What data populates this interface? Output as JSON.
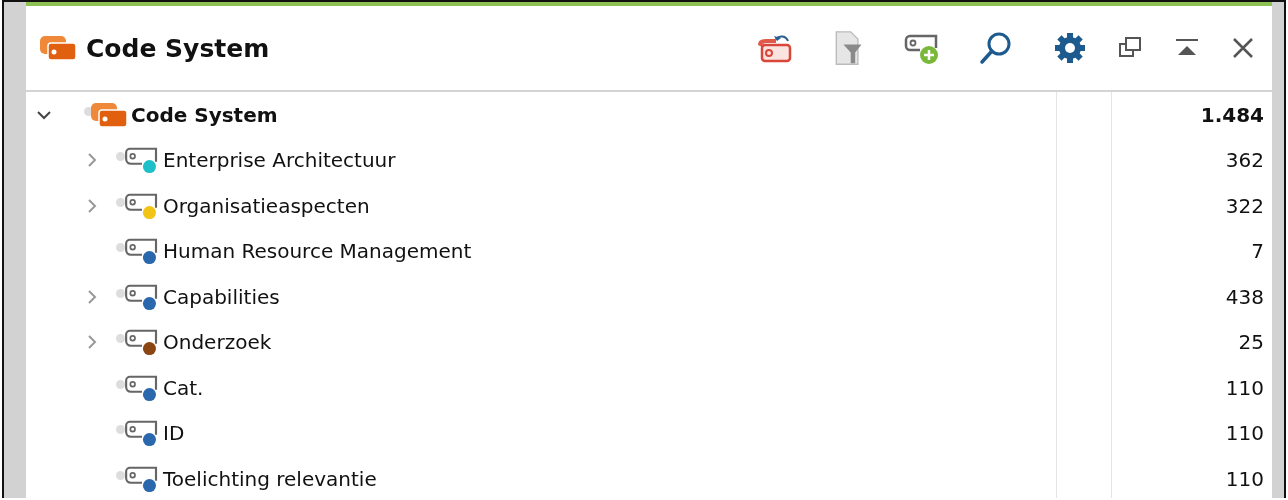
{
  "panel": {
    "title": "Code System"
  },
  "tree": {
    "label": "Code System",
    "count": "1.484",
    "expanded": true,
    "children": [
      {
        "label": "Enterprise Architectuur",
        "count": "362",
        "expandable": true,
        "color": "#1fbfc9"
      },
      {
        "label": "Organisatieaspecten",
        "count": "322",
        "expandable": true,
        "color": "#f2c416"
      },
      {
        "label": "Human Resource Management",
        "count": "7",
        "expandable": false,
        "color": "#2a67ad"
      },
      {
        "label": "Capabilities",
        "count": "438",
        "expandable": true,
        "color": "#2a67ad"
      },
      {
        "label": "Onderzoek",
        "count": "25",
        "expandable": true,
        "color": "#8b4513"
      },
      {
        "label": "Cat.",
        "count": "110",
        "expandable": false,
        "color": "#2a67ad"
      },
      {
        "label": "ID",
        "count": "110",
        "expandable": false,
        "color": "#2a67ad"
      },
      {
        "label": "Toelichting relevantie",
        "count": "110",
        "expandable": false,
        "color": "#2a67ad"
      }
    ]
  }
}
